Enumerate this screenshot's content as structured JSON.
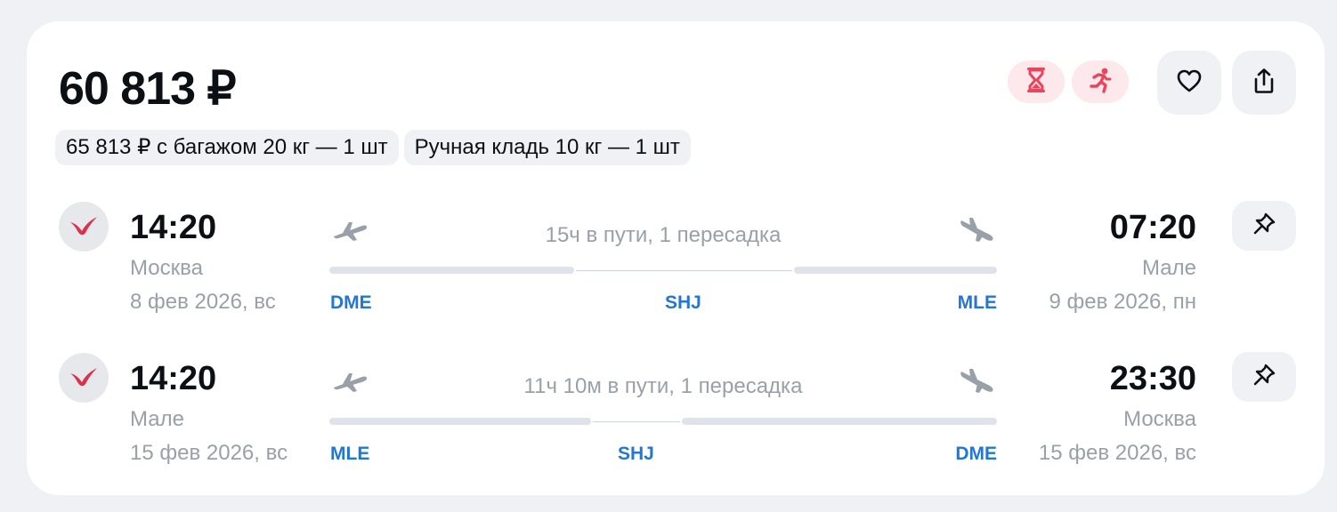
{
  "offer": {
    "price": "60 813 ₽",
    "baggage_label": "65 813 ₽ с багажом 20 кг — 1 шт",
    "hand_luggage_label": "Ручная кладь 10 кг — 1 шт",
    "accent_color": "#e8465c"
  },
  "segments": [
    {
      "depart_time": "14:20",
      "depart_city": "Москва",
      "depart_date": "8 фев 2026, вс",
      "arrive_time": "07:20",
      "arrive_city": "Мале",
      "arrive_date": "9 фев 2026, пн",
      "duration": "15ч в пути, 1 пересадка",
      "from_code": "DME",
      "via_code": "SHJ",
      "to_code": "MLE"
    },
    {
      "depart_time": "14:20",
      "depart_city": "Мале",
      "depart_date": "15 фев 2026, вс",
      "arrive_time": "23:30",
      "arrive_city": "Москва",
      "arrive_date": "15 фев 2026, вс",
      "duration": "11ч 10м в пути, 1 пересадка",
      "from_code": "MLE",
      "via_code": "SHJ",
      "to_code": "DME"
    }
  ],
  "icons": {
    "timer": "hourglass-icon",
    "running": "running-person-icon",
    "favorite": "heart-icon",
    "share": "share-icon",
    "pin": "pin-icon",
    "airline": "airline-logo-icon",
    "takeoff": "plane-takeoff-icon",
    "landing": "plane-landing-icon"
  }
}
